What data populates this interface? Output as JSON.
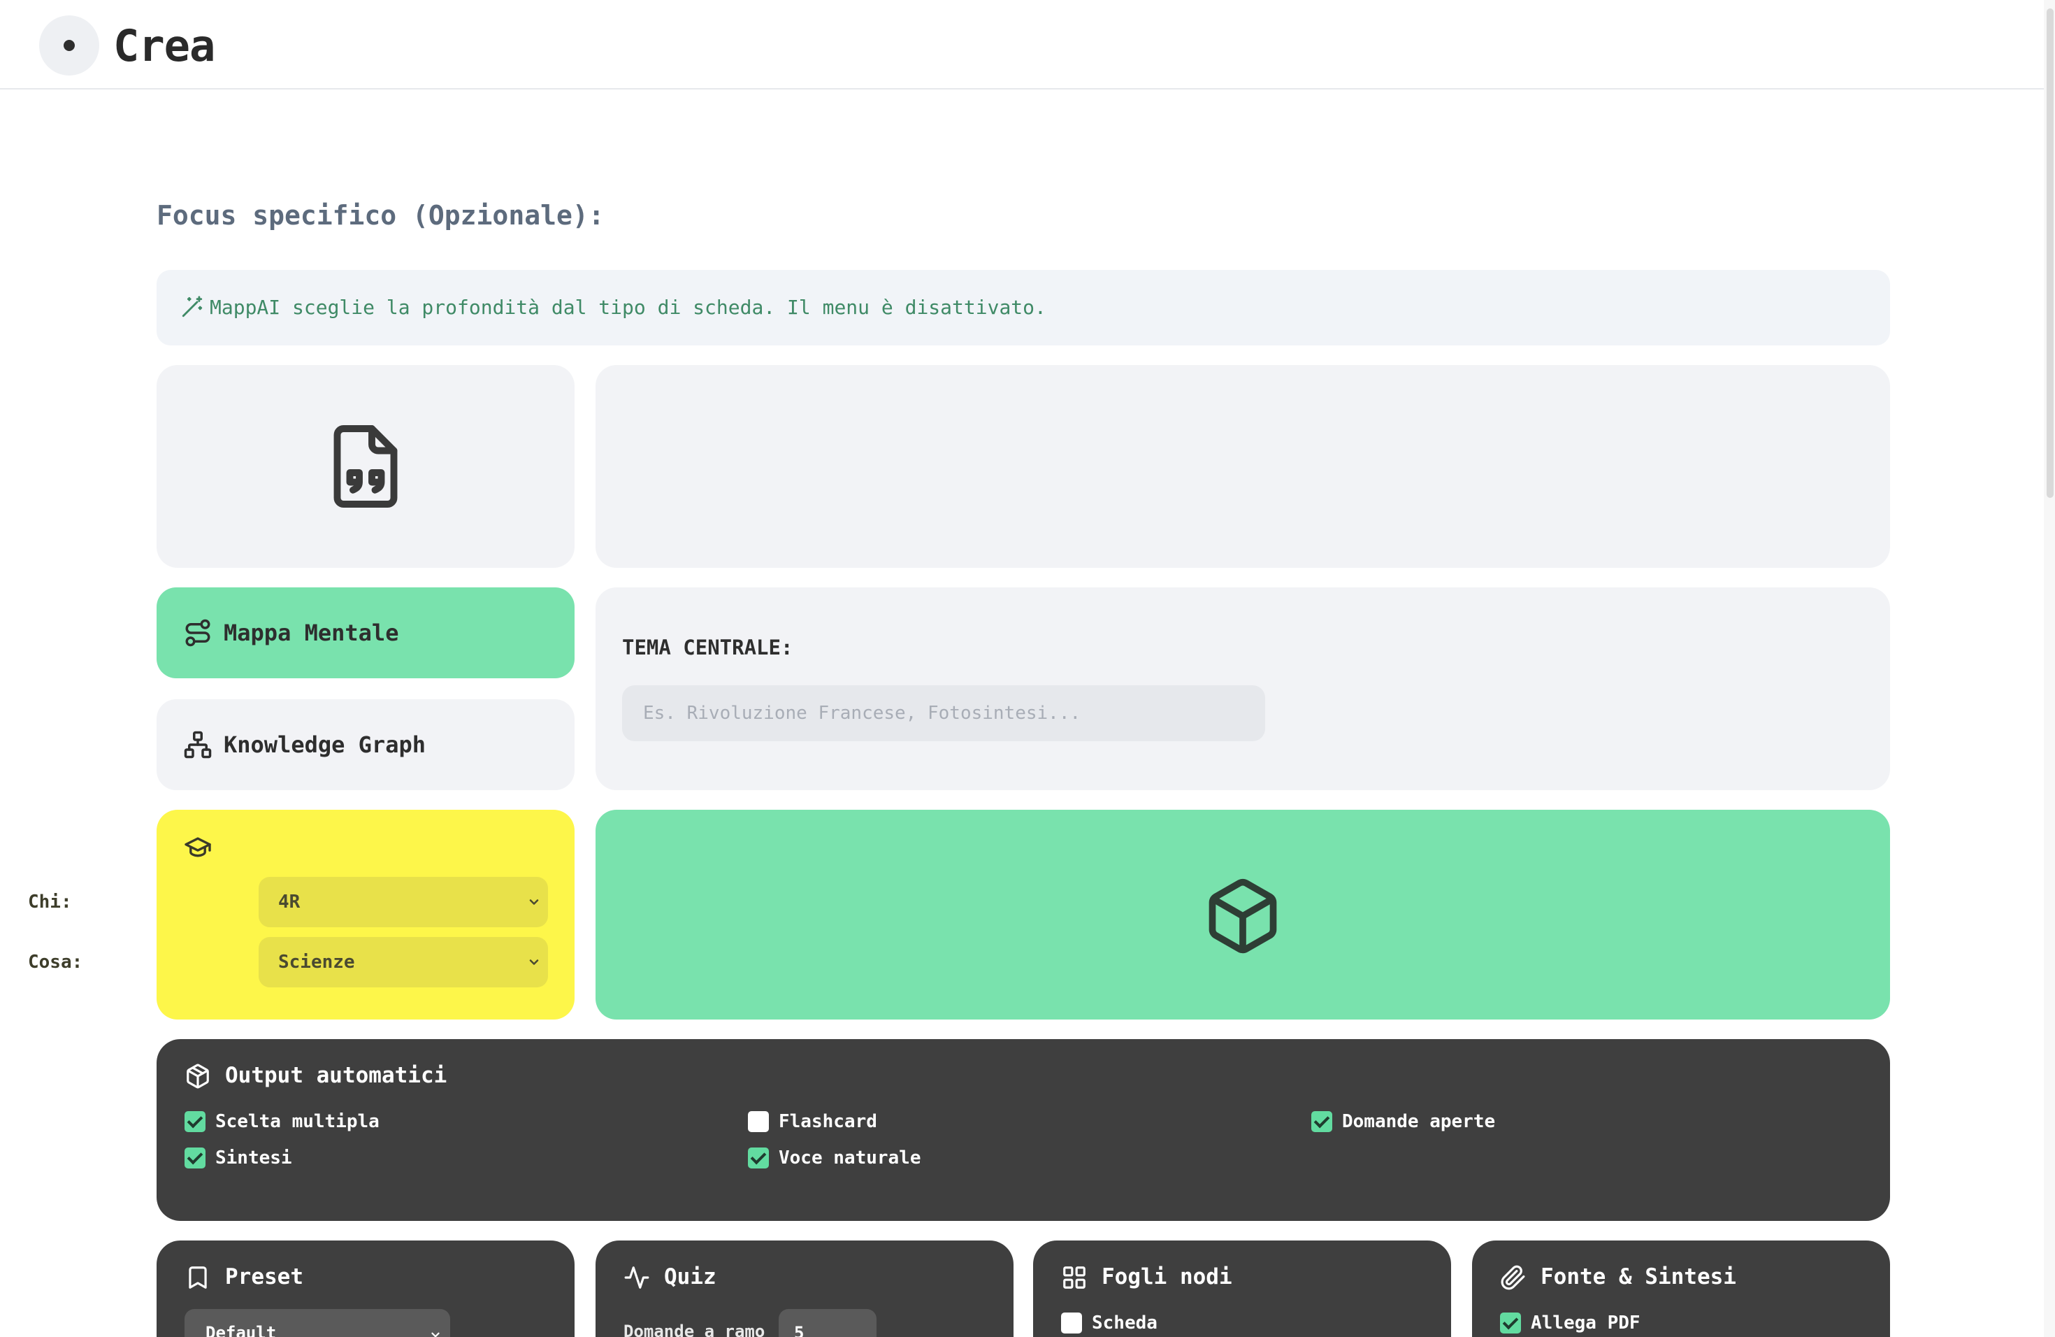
{
  "header": {
    "title": "Crea"
  },
  "focus": {
    "label": "Focus specifico (Opzionale):"
  },
  "info": {
    "text": "MappAI sceglie la profondità dal tipo di scheda. Il menu è disattivato."
  },
  "types": {
    "mappa_mentale": "Mappa Mentale",
    "knowledge_graph": "Knowledge Graph",
    "active": "mappa_mentale"
  },
  "tema": {
    "label": "TEMA CENTRALE:",
    "placeholder": "Es. Rivoluzione Francese, Fotosintesi...",
    "value": ""
  },
  "audience": {
    "chi_label": "Chi:",
    "chi_value": "4R",
    "cosa_label": "Cosa:",
    "cosa_value": "Scienze"
  },
  "outputs": {
    "title": "Output automatici",
    "items": [
      {
        "label": "Scelta multipla",
        "checked": true
      },
      {
        "label": "Flashcard",
        "checked": false
      },
      {
        "label": "Domande aperte",
        "checked": true
      },
      {
        "label": "Sintesi",
        "checked": true
      },
      {
        "label": "Voce naturale",
        "checked": true
      }
    ]
  },
  "preset": {
    "title": "Preset",
    "value": "Default"
  },
  "quiz": {
    "title": "Quiz",
    "domande_label": "Domande a ramo",
    "domande_value": "5"
  },
  "fogli": {
    "title": "Fogli nodi",
    "scheda_label": "Scheda",
    "scheda_checked": false
  },
  "fonte": {
    "title": "Fonte & Sintesi",
    "allega_label": "Allega PDF",
    "allega_checked": true
  },
  "colors": {
    "accent_green": "#79e2ad",
    "accent_yellow": "#fdf64a",
    "dark_card": "#3f3f3f",
    "info_text": "#3f8a66"
  }
}
